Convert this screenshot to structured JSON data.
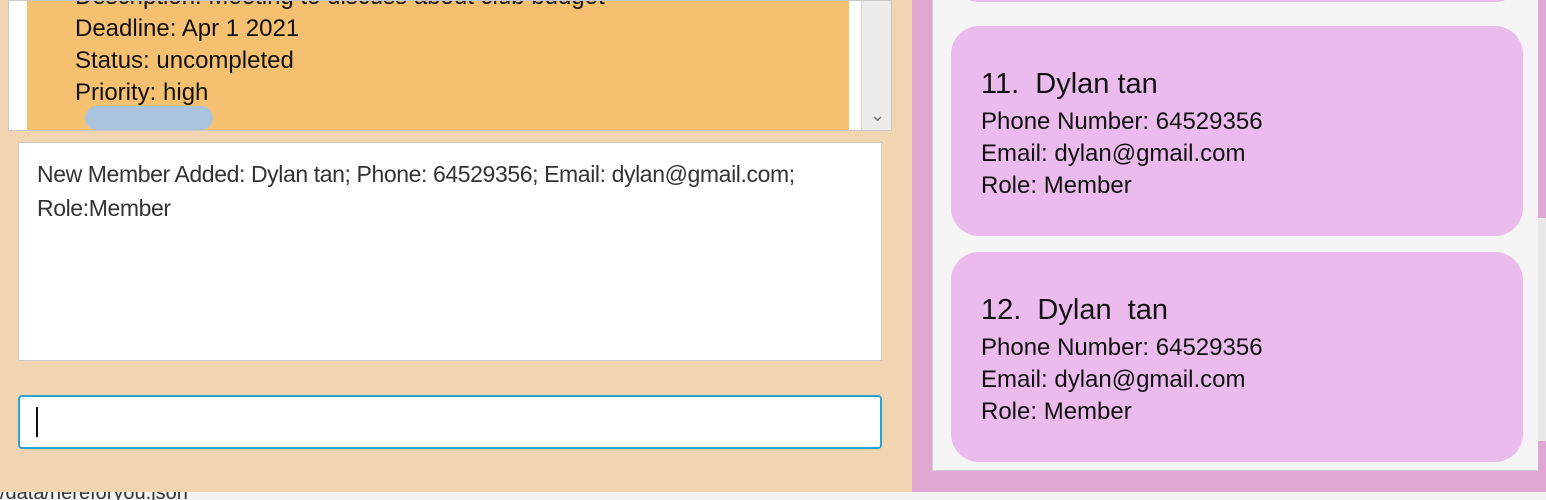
{
  "task_card": {
    "description": "Description: Meeting to discuss about club budget",
    "deadline": "Deadline: Apr 1 2021",
    "status": "Status: uncompleted",
    "priority": "Priority: high"
  },
  "result_display": {
    "text": "New Member Added: Dylan  tan; Phone: 64529356; Email: dylan@gmail.com; Role:Member"
  },
  "command_box": {
    "value": "",
    "placeholder": ""
  },
  "members": [
    {
      "name": "11.  Dylan tan",
      "phone": "Phone Number: 64529356",
      "email": "Email: dylan@gmail.com",
      "role": "Role: Member"
    },
    {
      "name": "12.  Dylan  tan",
      "phone": "Phone Number: 64529356",
      "email": "Email: dylan@gmail.com",
      "role": "Role: Member"
    }
  ],
  "status_bar": {
    "text": "/data/hereforyou.json"
  },
  "colors": {
    "left_background": "#f0d5b0",
    "task_card": "#f5c070",
    "member_card": "#ebbbee",
    "right_background": "#e1a7d3",
    "command_focus_border": "#2aa3d0"
  }
}
